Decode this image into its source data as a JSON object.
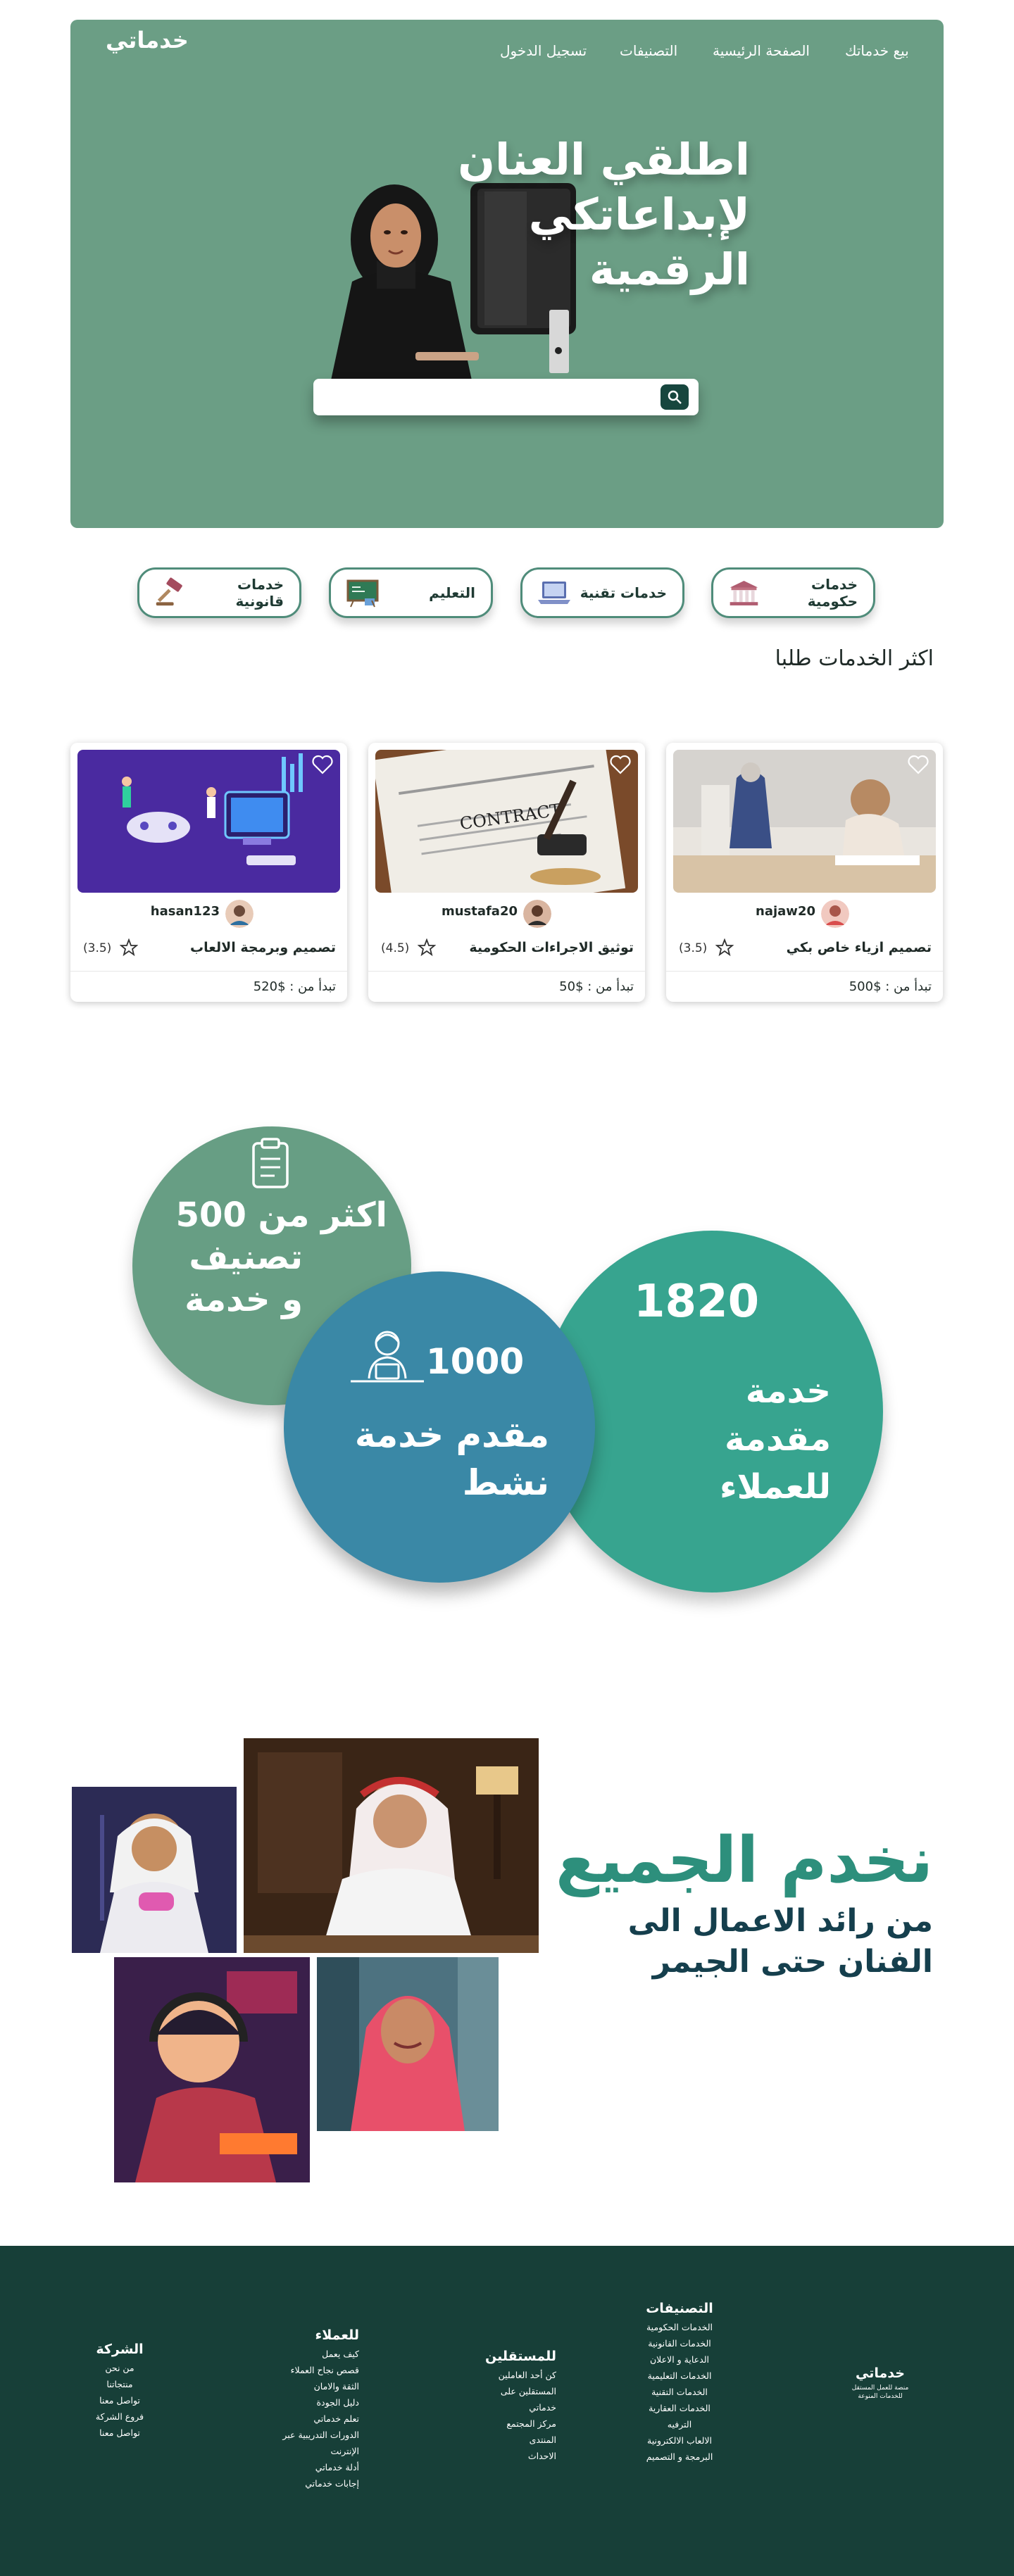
{
  "header": {
    "logo": "خدماتي",
    "nav": [
      "بيع خدماتك",
      "الصفحة الرئيسية",
      "التصنيفات",
      "تسجيل الدخول"
    ]
  },
  "hero": {
    "title_line1": "اطلقي العنان لإبداعاتكي",
    "title_line2": "الرقمية",
    "search_placeholder": "",
    "search_icon": "search-icon"
  },
  "categories": [
    {
      "label": "خدمات حكومية",
      "icon": "government-building-icon"
    },
    {
      "label": "خدمات تقنية",
      "icon": "laptop-icon"
    },
    {
      "label": "التعليم",
      "icon": "chalkboard-icon"
    },
    {
      "label": "خدمات قانونية",
      "icon": "gavel-icon"
    }
  ],
  "popular": {
    "title": "اكثر الخدمات طلبا",
    "cards": [
      {
        "title": "تصميم ازياء خاص بكي",
        "user": "najaw20",
        "rating": "(3.5)",
        "price": "تبدأ من : $500"
      },
      {
        "title": "توثيق الاجراءات الحكومية",
        "user": "mustafa20",
        "rating": "(4.5)",
        "price": "تبدأ من : $50"
      },
      {
        "title": "تصميم وبرمجة الالعاب",
        "user": "hasan123",
        "rating": "(3.5)",
        "price": "تبدأ من : $520"
      }
    ]
  },
  "stats": {
    "categories_line1": "اكثر من 500",
    "categories_line2": "تصنيف",
    "categories_line3": "و خدمة",
    "providers_number": "1000",
    "providers_line1": "مقدم خدمة",
    "providers_line2": "نشط",
    "services_number": "1820",
    "services_line1": "خدمة",
    "services_line2": "مقدمة",
    "services_line3": "للعملاء"
  },
  "serve": {
    "title": "نخدم الجميع",
    "sub_line1": "من رائد الاعمال الى",
    "sub_line2": "الفنان حتى الجيمر"
  },
  "footer": {
    "brand": "خدماتي",
    "brand_desc_1": "منصة للعمل المستقل",
    "brand_desc_2": "للخدمات المنوعة",
    "columns": [
      {
        "title": "التصنيفات",
        "items": [
          "الخدمات الحكومية",
          "الخدمات القانونية",
          "الدعاية و الاعلان",
          "الخدمات التعليمية",
          "الخدمات التقنية",
          "الخدمات العقارية",
          "الترفيه",
          "الالعاب الالكترونية",
          "البرمجة و التصميم"
        ]
      },
      {
        "title": "للمستقلين",
        "items": [
          "كن أحد العاملين",
          "المستقلين على",
          "خدماتي",
          "مركز المجتمع",
          "المنتدى",
          "الاحداث"
        ]
      },
      {
        "title": "للعملاء",
        "items": [
          "كيف يعمل",
          "قصص نجاح العملاء",
          "الثقة والامان",
          "دليل الجودة",
          "تعلم خدماتي",
          "الدورات التدريبية عبر",
          "الإنترنت",
          "أدلة خدماتي",
          "إجابات خدماتي"
        ]
      },
      {
        "title": "الشركة",
        "items": [
          "من نحن",
          "منتجاتنا",
          "تواصل معنا",
          "فروع الشركة",
          "تواصل معنا"
        ]
      }
    ]
  },
  "colors": {
    "hero": "#6b9e85",
    "footer": "#173f38",
    "accent": "#2d8f7c",
    "navy": "#153f4d"
  }
}
